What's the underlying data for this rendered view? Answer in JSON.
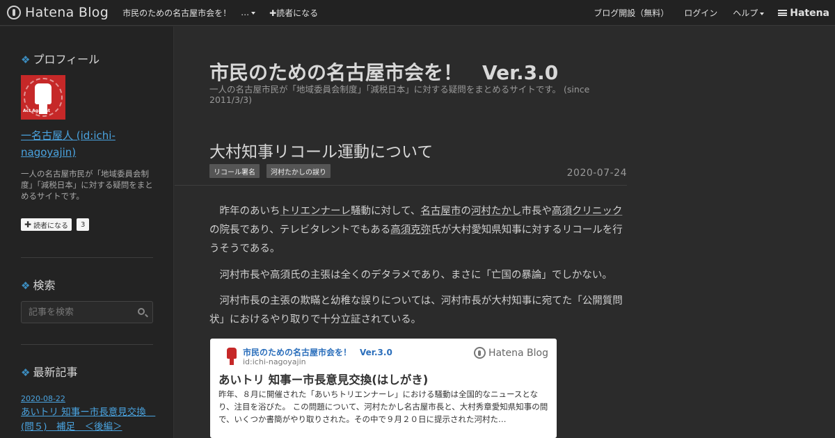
{
  "topbar": {
    "brand": "Hatena Blog",
    "blog_name": "市民のための名古屋市会を！",
    "more": "…",
    "subscribe": "✚読者になる",
    "create_blog": "ブログ開設（無料）",
    "login": "ログイン",
    "help": "ヘルプ",
    "hatena": "Hatena"
  },
  "sidebar": {
    "profile": {
      "title": "プロフィール",
      "avatar_text": "Act Against",
      "name": "一名古屋人 (id:ichi-nagoyajin)",
      "description": "一人の名古屋市民が「地域委員会制度」「減税日本」に対する疑問をまとめるサイトです。",
      "subscribe_label": "読者になる",
      "subscribe_count": "3"
    },
    "search": {
      "title": "検索",
      "placeholder": "記事を検索"
    },
    "recent": {
      "title": "最新記事",
      "items": [
        {
          "date": "2020-08-22",
          "title": "あいトリ 知事ー市長意見交換　(問５)　補足　＜後編＞"
        }
      ]
    }
  },
  "main": {
    "blog_title": "市民のための名古屋市会を！　Ver.3.0",
    "blog_description": "一人の名古屋市民が「地域委員会制度」「減税日本」に対する疑問をまとめるサイトです。 (since 2011/3/3)",
    "entry": {
      "title": "大村知事リコール運動について",
      "tags": [
        "リコール署名",
        "河村たかしの誤り"
      ],
      "date": "2020-07-24",
      "p1": {
        "a": "　昨年のあいち",
        "link1": "トリエンナーレ",
        "b": "騒動に対して、",
        "link2": "名古屋市",
        "c": "の",
        "link3": "河村たかし",
        "d": "市長や",
        "link4": "高須クリニック",
        "e": "の院長であり、テレビタレントでもある",
        "link5": "高須克弥",
        "f": "氏が大村愛知県知事に対するリコールを行うそうである。"
      },
      "p2": "　河村市長や高須氏の主張は全くのデタラメであり、まさに「亡国の暴論」でしかない。",
      "p3": "　河村市長の主張の欺瞞と幼稚な誤りについては、河村市長が大村知事に宛てた「公開質問状」におけるやり取りで十分立証されている。"
    },
    "embed": {
      "blog_name": "市民のための名古屋市会を！　Ver.3.0",
      "id": "id:ichi-nagoyajin",
      "brand": "Hatena Blog",
      "title": "あいトリ 知事ー市長意見交換(はしがき)",
      "text": "昨年、８月に開催された「あいちトリエンナーレ」における騒動は全国的なニュースとなり、注目を浴びた。 この問題について、河村たかし名古屋市長と、大村秀章愛知県知事の間で、いくつか書簡がやり取りされた。その中で９月２０日に提示された河村た…"
    }
  }
}
